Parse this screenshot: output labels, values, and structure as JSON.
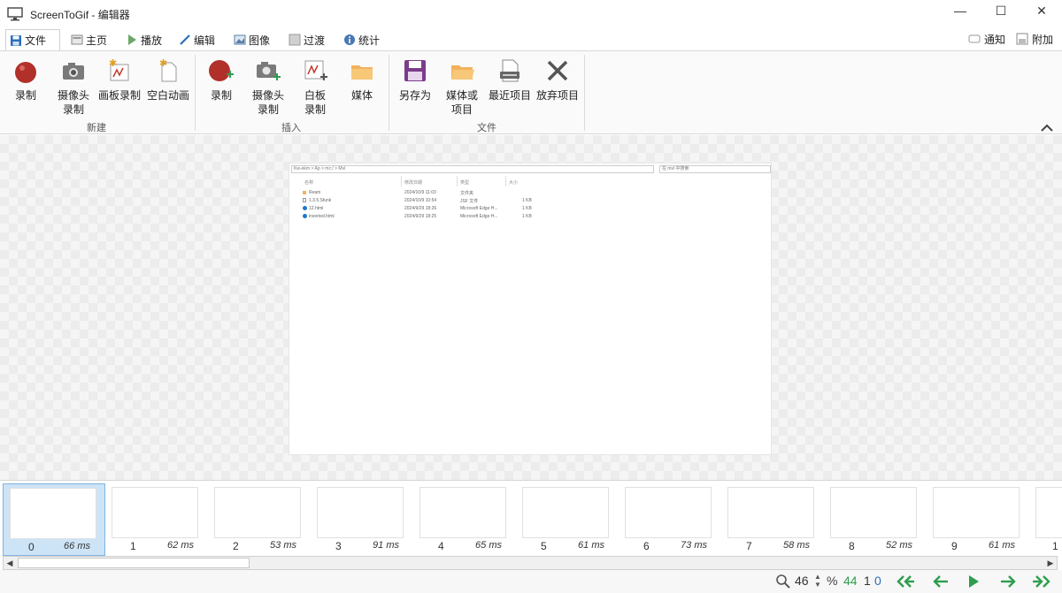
{
  "window": {
    "title": "ScreenToGif - 编辑器",
    "minimize": "—",
    "maximize": "☐",
    "close": "✕"
  },
  "tabs": [
    {
      "label": "文件",
      "icon": "save-icon",
      "active": true
    },
    {
      "label": "主页",
      "icon": "home-icon"
    },
    {
      "label": "播放",
      "icon": "play-icon"
    },
    {
      "label": "编辑",
      "icon": "pencil-icon"
    },
    {
      "label": "图像",
      "icon": "image-icon"
    },
    {
      "label": "过渡",
      "icon": "transition-icon"
    },
    {
      "label": "统计",
      "icon": "info-icon"
    }
  ],
  "right_tabs": {
    "notify": "通知",
    "attach": "附加"
  },
  "ribbon": {
    "groups": [
      {
        "label": "新建",
        "buttons": [
          "录制",
          "摄像头\n录制",
          "画板录制",
          "空白动画"
        ]
      },
      {
        "label": "插入",
        "buttons": [
          "录制",
          "摄像头\n录制",
          "白板\n录制",
          "媒体"
        ]
      },
      {
        "label": "文件",
        "buttons": [
          "另存为",
          "媒体或\n项目",
          "最近项目",
          "放弃项目"
        ]
      }
    ]
  },
  "preview": {
    "address": "Kw-ekm > Ap > mc:/ > Mvl",
    "search": "在 mvl 中搜索",
    "headers": [
      "名称",
      "修改日期",
      "类型",
      "大小"
    ],
    "rows": [
      {
        "name": "Ream",
        "date": "2024/10/9 11:03",
        "type": "文件夹",
        "size": ""
      },
      {
        "name": "1.3.5.Sfunk",
        "date": "2024/10/9 10:54",
        "type": "JSF 文件",
        "size": "1 KB"
      },
      {
        "name": "12.html",
        "date": "2024/9/29 18:26",
        "type": "Microsoft Edge H...",
        "size": "1 KB"
      },
      {
        "name": "inverted.html",
        "date": "2024/9/29 18:25",
        "type": "Microsoft Edge H...",
        "size": "1 KB"
      }
    ]
  },
  "frames": [
    {
      "index": "0",
      "ms": "66 ms",
      "selected": true
    },
    {
      "index": "1",
      "ms": "62 ms"
    },
    {
      "index": "2",
      "ms": "53 ms"
    },
    {
      "index": "3",
      "ms": "91 ms"
    },
    {
      "index": "4",
      "ms": "65 ms"
    },
    {
      "index": "5",
      "ms": "61 ms"
    },
    {
      "index": "6",
      "ms": "73 ms"
    },
    {
      "index": "7",
      "ms": "58 ms"
    },
    {
      "index": "8",
      "ms": "52 ms"
    },
    {
      "index": "9",
      "ms": "61 ms"
    },
    {
      "index": "1",
      "ms": ""
    }
  ],
  "status": {
    "zoom": "46",
    "zoom_unit": "%",
    "frame_count": "44",
    "selected_count": "1",
    "current_index": "0"
  },
  "colors": {
    "record_red": "#c0392b",
    "accent_blue": "#2a6ebb",
    "save_purple": "#7b3c8a",
    "folder_orange": "#f2b25c",
    "nav_green": "#2e9d4f"
  }
}
